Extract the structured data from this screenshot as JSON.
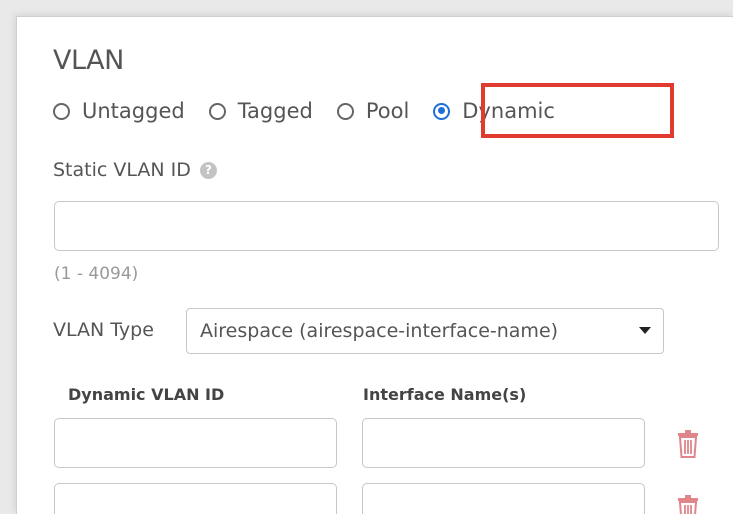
{
  "section_title": "VLAN",
  "vlan_mode": {
    "options": [
      {
        "label": "Untagged",
        "checked": false
      },
      {
        "label": "Tagged",
        "checked": false
      },
      {
        "label": "Pool",
        "checked": false
      },
      {
        "label": "Dynamic",
        "checked": true
      }
    ]
  },
  "static_vlan": {
    "label": "Static VLAN ID",
    "value": "",
    "range_hint": "(1 - 4094)"
  },
  "vlan_type": {
    "label": "VLAN Type",
    "selected": "Airespace (airespace-interface-name)"
  },
  "dynamic_table": {
    "headers": [
      "Dynamic VLAN ID",
      "Interface Name(s)"
    ]
  },
  "colors": {
    "accent": "#1e6fd9",
    "highlight": "#e03b2e",
    "delete": "#e0868a"
  },
  "icons": {
    "help": "help-circle-icon",
    "select": "caret-down-icon",
    "delete": "trash-icon"
  }
}
